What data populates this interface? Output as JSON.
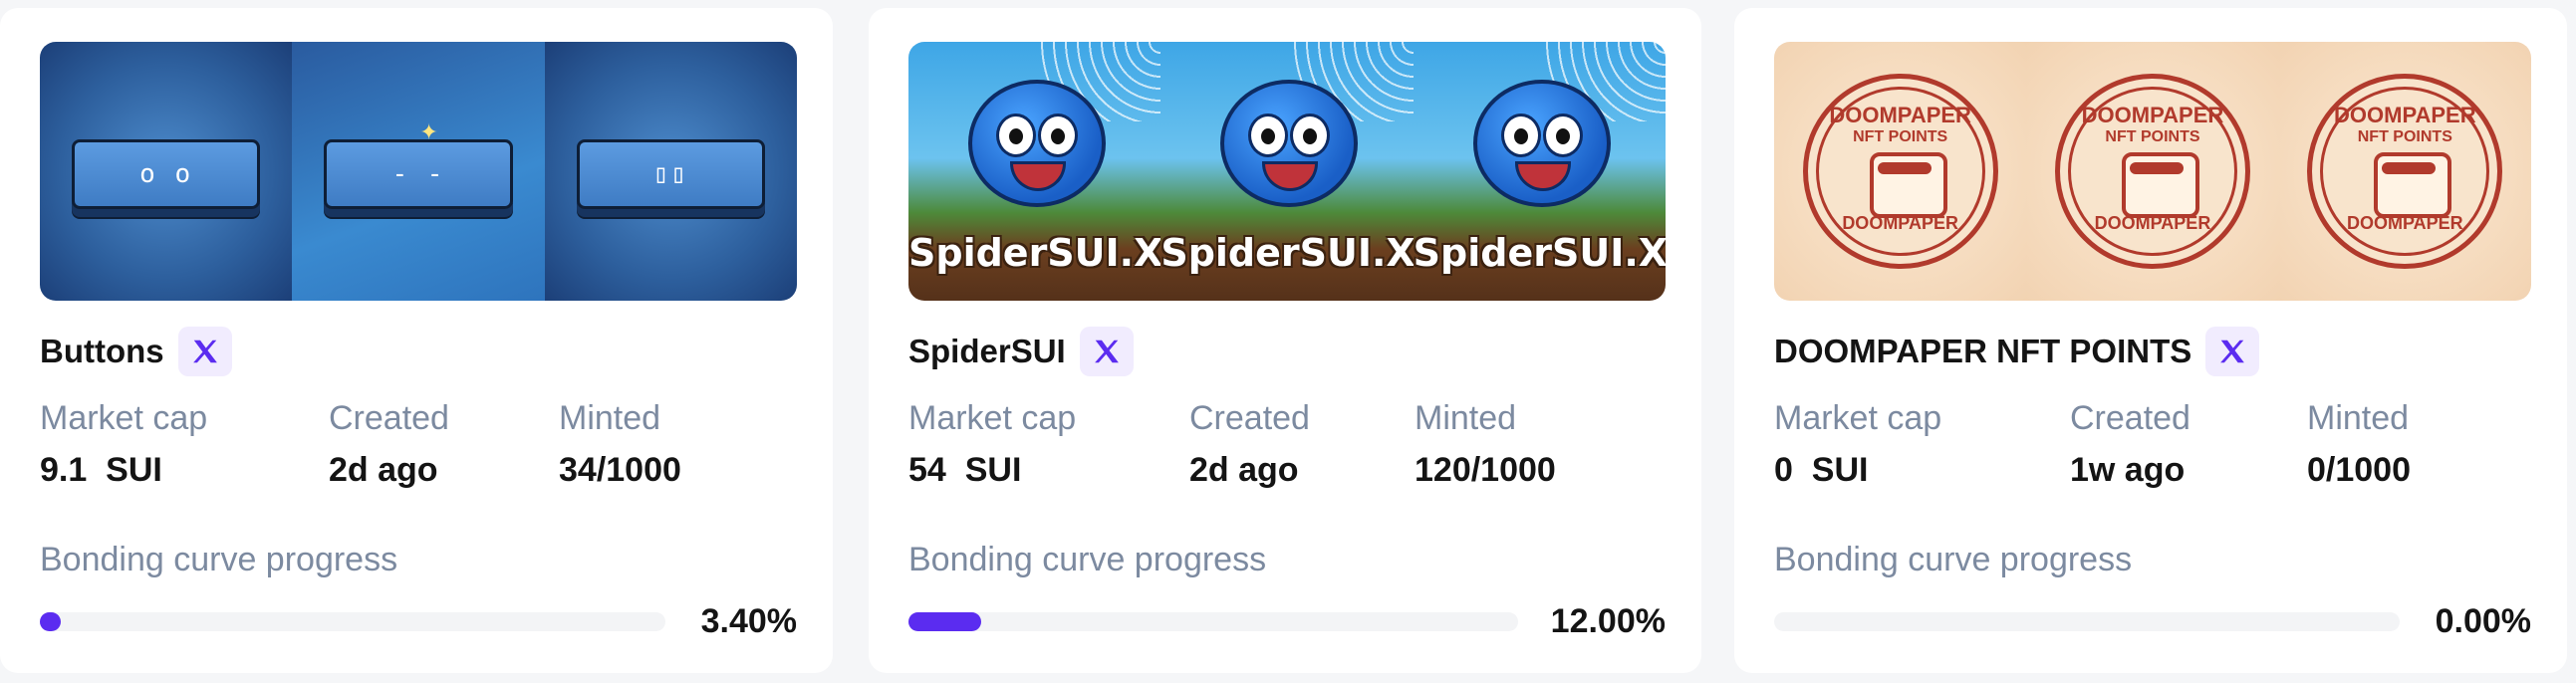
{
  "accent_color": "#5b2cf0",
  "cards": [
    {
      "name": "Buttons",
      "social_icon": "x-icon",
      "market_cap_label": "Market cap",
      "market_cap": "9.1  SUI",
      "created_label": "Created",
      "created": "2d ago",
      "minted_label": "Minted",
      "minted": "34/1000",
      "progress_label": "Bonding curve progress",
      "progress_text": "3.40%",
      "progress_value": 0.034
    },
    {
      "name": "SpiderSUI",
      "social_icon": "x-icon",
      "banner_text": "SpiderSUI.XYZ",
      "market_cap_label": "Market cap",
      "market_cap": "54  SUI",
      "created_label": "Created",
      "created": "2d ago",
      "minted_label": "Minted",
      "minted": "120/1000",
      "progress_label": "Bonding curve progress",
      "progress_text": "12.00%",
      "progress_value": 0.12
    },
    {
      "name": "DOOMPAPER NFT POINTS",
      "social_icon": "x-icon",
      "banner_text_top": "DOOMPAPER",
      "banner_text_mid": "NFT POINTS",
      "banner_text_bottom": "DOOMPAPER",
      "market_cap_label": "Market cap",
      "market_cap": "0  SUI",
      "created_label": "Created",
      "created": "1w ago",
      "minted_label": "Minted",
      "minted": "0/1000",
      "progress_label": "Bonding curve progress",
      "progress_text": "0.00%",
      "progress_value": 0.0
    }
  ]
}
